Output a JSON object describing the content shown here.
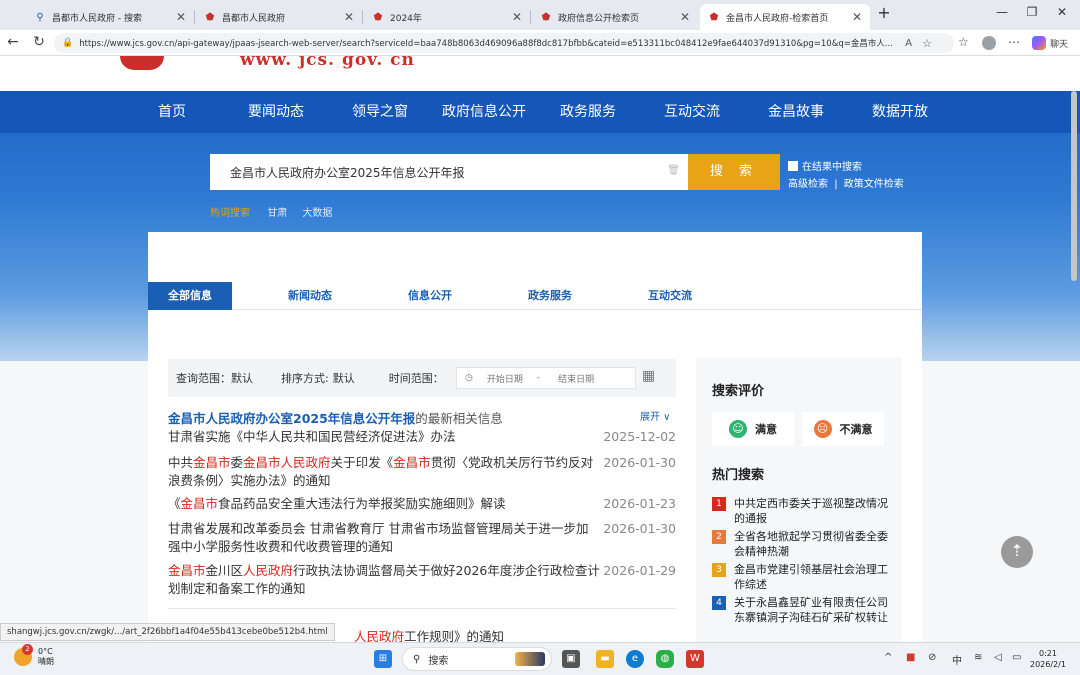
{
  "browser": {
    "tabs": [
      {
        "title": "昌都市人民政府 - 搜索",
        "icon": "search-icon"
      },
      {
        "title": "昌都市人民政府",
        "icon": "emblem-icon"
      },
      {
        "title": "2024年",
        "icon": "emblem-icon"
      },
      {
        "title": "政府信息公开检索页",
        "icon": "emblem-icon"
      },
      {
        "title": "金昌市人民政府-检索首页",
        "icon": "emblem-icon",
        "active": true
      }
    ],
    "url": "https://www.jcs.gov.cn/api-gateway/jpaas-jsearch-web-server/search?serviceId=baa748b8063d469096a88f8dc817bfbb&cateid=e513311bc048412e9fae644037d91310&pg=10&q=金昌市人...",
    "copilot_label": "聊天"
  },
  "site": {
    "logo_url": "www. jcs. gov. cn",
    "nav": [
      "首页",
      "要闻动态",
      "领导之窗",
      "政府信息公开",
      "政务服务",
      "互动交流",
      "金昌故事",
      "数据开放"
    ],
    "search": {
      "query": "金昌市人民政府办公室2025年信息公开年报",
      "button": "搜 索",
      "in_results": "在结果中搜索",
      "advanced": "高级检索",
      "policy": "政策文件检索",
      "hot_label": "热词搜索",
      "hot_words": [
        "甘肃",
        "大数据"
      ]
    },
    "scope_tabs": [
      "全部信息",
      "新闻动态",
      "信息公开",
      "政务服务",
      "互动交流"
    ],
    "filter": {
      "scope_label": "查询范围：",
      "scope_value": "默认",
      "sort_label": "排序方式:",
      "sort_value": "默认",
      "time_label": "时间范围：",
      "start_placeholder": "开始日期",
      "dash": "-",
      "end_placeholder": "结束日期"
    },
    "result_header": {
      "highlight": "金昌市人民政府办公室2025年信息公开年报",
      "suffix": "的最新相关信息",
      "expand": "展开 ∨"
    },
    "results": [
      {
        "title_html": "甘肃省实施《中华人民共和国民营经济促进法》办法",
        "date": "2025-12-02"
      },
      {
        "title_html": "中共<span class='hl-red'>金昌市</span>委<span class='hl-red'>金昌市人民政府</span>关于印发《<span class='hl-red'>金昌市</span>贯彻〈党政机关厉行节约反对浪费条例〉实施办法》的通知",
        "date": "2026-01-30"
      },
      {
        "title_html": "《<span class='hl-red'>金昌市</span>食品药品安全重大违法行为举报奖励实施细则》解读",
        "date": "2026-01-23"
      },
      {
        "title_html": "甘肃省发展和改革委员会 甘肃省教育厅 甘肃省市场监督管理局关于进一步加强中小学服务性收费和代收费管理的通知",
        "date": "2026-01-30"
      },
      {
        "title_html": "<span class='hl-red'>金昌市</span>金川区<span class='hl-red'>人民政府</span>行政执法协调监督局关于做好2026年度涉企行政检查计划制定和备案工作的通知",
        "date": "2026-01-29"
      }
    ],
    "partial_row": "<span class='hl-red'>人民政府</span>工作规则》的通知",
    "side": {
      "eval_title": "搜索评价",
      "satisfied": "满意",
      "unsatisfied": "不满意",
      "hot_title": "热门搜索",
      "hot_items": [
        {
          "num": "1",
          "text": "中共定西市委关于巡视整改情况的通报",
          "color": "#d42a1e"
        },
        {
          "num": "2",
          "text": "全省各地掀起学习贯彻省委全委会精神热潮",
          "color": "#e8793a"
        },
        {
          "num": "3",
          "text": "金昌市党建引领基层社会治理工作综述",
          "color": "#e8a317"
        },
        {
          "num": "4",
          "text": "关于永昌鑫昱矿业有限责任公司东寨镇洞子沟硅石矿采矿权转让信息公示",
          "color": "#1b5fb5"
        }
      ]
    },
    "status_url": "shangwj.jcs.gov.cn/zwgk/.../art_2f26bbf1a4f04e55b413cebe0be512b4.html"
  },
  "taskbar": {
    "weather_badge": "2",
    "temp": "0°C",
    "condition": "晴朗",
    "search_placeholder": "搜索",
    "ime": "中",
    "time": "0:21",
    "date": "2026/2/1"
  }
}
